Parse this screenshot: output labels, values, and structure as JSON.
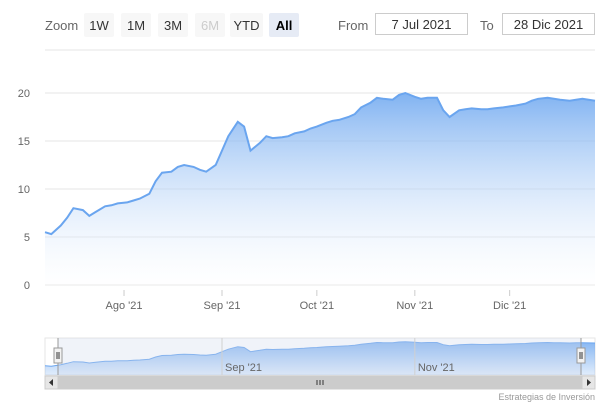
{
  "toolbar": {
    "zoom_label": "Zoom",
    "buttons": [
      {
        "label": "1W",
        "state": "normal"
      },
      {
        "label": "1M",
        "state": "normal"
      },
      {
        "label": "3M",
        "state": "normal"
      },
      {
        "label": "6M",
        "state": "disabled"
      },
      {
        "label": "YTD",
        "state": "normal"
      },
      {
        "label": "All",
        "state": "active"
      }
    ],
    "from_label": "From",
    "from_value": "7 Jul 2021",
    "to_label": "To",
    "to_value": "28 Dic 2021"
  },
  "navigator": {
    "labels": [
      "Sep '21",
      "Nov '21"
    ],
    "scrollbar_grip": "scroll-grip-icon",
    "left_arrow": "left-arrow-icon",
    "right_arrow": "right-arrow-icon"
  },
  "credits": "Estrategias de Inversión",
  "colors": {
    "series_line": "#6aa5ef",
    "series_fill_top": "#6aa5ef",
    "series_fill_bottom": "#ffffff",
    "grid": "#e6e6e6",
    "navigator_mask": "#ccd6eb"
  },
  "chart_data": {
    "type": "area",
    "title": "",
    "xlabel": "",
    "ylabel": "",
    "ylim": [
      0,
      20
    ],
    "yticks": [
      0,
      5,
      10,
      15,
      20
    ],
    "xlim": [
      "2021-07-07",
      "2021-12-28"
    ],
    "xticks": [
      {
        "date": "2021-08-01",
        "label": "Ago '21"
      },
      {
        "date": "2021-09-01",
        "label": "Sep '21"
      },
      {
        "date": "2021-10-01",
        "label": "Oct '21"
      },
      {
        "date": "2021-11-01",
        "label": "Nov '21"
      },
      {
        "date": "2021-12-01",
        "label": "Dic '21"
      }
    ],
    "grid": true,
    "legend": "none",
    "series": [
      {
        "x": [
          "2021-07-07",
          "2021-07-09",
          "2021-07-12",
          "2021-07-14",
          "2021-07-16",
          "2021-07-19",
          "2021-07-21",
          "2021-07-23",
          "2021-07-26",
          "2021-07-28",
          "2021-07-30",
          "2021-08-02",
          "2021-08-04",
          "2021-08-06",
          "2021-08-09",
          "2021-08-11",
          "2021-08-13",
          "2021-08-16",
          "2021-08-18",
          "2021-08-20",
          "2021-08-23",
          "2021-08-25",
          "2021-08-27",
          "2021-08-30",
          "2021-09-01",
          "2021-09-03",
          "2021-09-06",
          "2021-09-08",
          "2021-09-10",
          "2021-09-13",
          "2021-09-15",
          "2021-09-17",
          "2021-09-20",
          "2021-09-22",
          "2021-09-24",
          "2021-09-27",
          "2021-09-29",
          "2021-10-01",
          "2021-10-04",
          "2021-10-06",
          "2021-10-08",
          "2021-10-11",
          "2021-10-13",
          "2021-10-15",
          "2021-10-18",
          "2021-10-20",
          "2021-10-22",
          "2021-10-25",
          "2021-10-27",
          "2021-10-29",
          "2021-11-01",
          "2021-11-03",
          "2021-11-05",
          "2021-11-08",
          "2021-11-10",
          "2021-11-12",
          "2021-11-15",
          "2021-11-17",
          "2021-11-19",
          "2021-11-22",
          "2021-11-24",
          "2021-11-26",
          "2021-11-29",
          "2021-12-01",
          "2021-12-03",
          "2021-12-06",
          "2021-12-08",
          "2021-12-10",
          "2021-12-13",
          "2021-12-15",
          "2021-12-17",
          "2021-12-20",
          "2021-12-22",
          "2021-12-24",
          "2021-12-28"
        ],
        "values": [
          5.5,
          5.3,
          6.2,
          7.0,
          8.0,
          7.8,
          7.2,
          7.6,
          8.2,
          8.3,
          8.5,
          8.6,
          8.8,
          9.0,
          9.5,
          10.8,
          11.7,
          11.8,
          12.3,
          12.5,
          12.3,
          12.0,
          11.8,
          12.5,
          14.0,
          15.5,
          17.0,
          16.5,
          14.0,
          14.8,
          15.5,
          15.3,
          15.4,
          15.5,
          15.8,
          16.0,
          16.3,
          16.5,
          16.9,
          17.1,
          17.2,
          17.5,
          17.8,
          18.5,
          19.0,
          19.5,
          19.4,
          19.3,
          19.8,
          20.0,
          19.6,
          19.4,
          19.5,
          19.5,
          18.2,
          17.5,
          18.2,
          18.3,
          18.4,
          18.3,
          18.3,
          18.4,
          18.5,
          18.6,
          18.7,
          18.9,
          19.2,
          19.4,
          19.5,
          19.4,
          19.3,
          19.2,
          19.3,
          19.4,
          19.2
        ]
      }
    ]
  }
}
